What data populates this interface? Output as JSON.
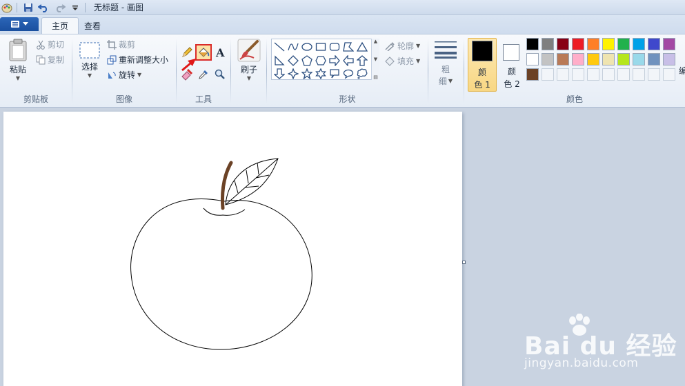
{
  "titlebar": {
    "title": "无标题 - 画图"
  },
  "tabs": {
    "file_label": "",
    "home": "主页",
    "view": "查看"
  },
  "clipboard": {
    "paste": "粘贴",
    "cut": "剪切",
    "copy": "复制",
    "group_label": "剪贴板"
  },
  "image": {
    "select": "选择",
    "crop": "裁剪",
    "resize": "重新调整大小",
    "rotate": "旋转",
    "group_label": "图像"
  },
  "tools": {
    "group_label": "工具",
    "selected_tool": "fill-icon"
  },
  "brushes": {
    "label": "刷子"
  },
  "shapes": {
    "outline": "轮廓",
    "fill": "填充",
    "group_label": "形状"
  },
  "size": {
    "label_line1": "粗",
    "label_line2": "细"
  },
  "colors": {
    "color1_line1": "颜",
    "color1_line2": "色 1",
    "color2_line1": "颜",
    "color2_line2": "色 2",
    "edit_partial": "编",
    "group_label": "颜色",
    "color1_value": "#000000",
    "color2_value": "#ffffff",
    "palette_row1": [
      "#000000",
      "#7f7f7f",
      "#880015",
      "#ed1c24",
      "#ff7f27",
      "#fff200",
      "#22b14c",
      "#00a2e8",
      "#3f48cc",
      "#a349a4"
    ],
    "palette_row2": [
      "#ffffff",
      "#c3c3c3",
      "#b97a57",
      "#ffaec9",
      "#ffc90e",
      "#efe4b0",
      "#b5e61d",
      "#99d9ea",
      "#7092be",
      "#c8bfe7"
    ],
    "palette_row3": [
      "#6b4226",
      "",
      "",
      "",
      "",
      "",
      "",
      "",
      "",
      ""
    ]
  },
  "drawing": {
    "stem_color": "#6b4226",
    "line_color": "#000000"
  },
  "watermark": {
    "brand": "Bai du 经验",
    "url": "jingyan.baidu.com"
  }
}
